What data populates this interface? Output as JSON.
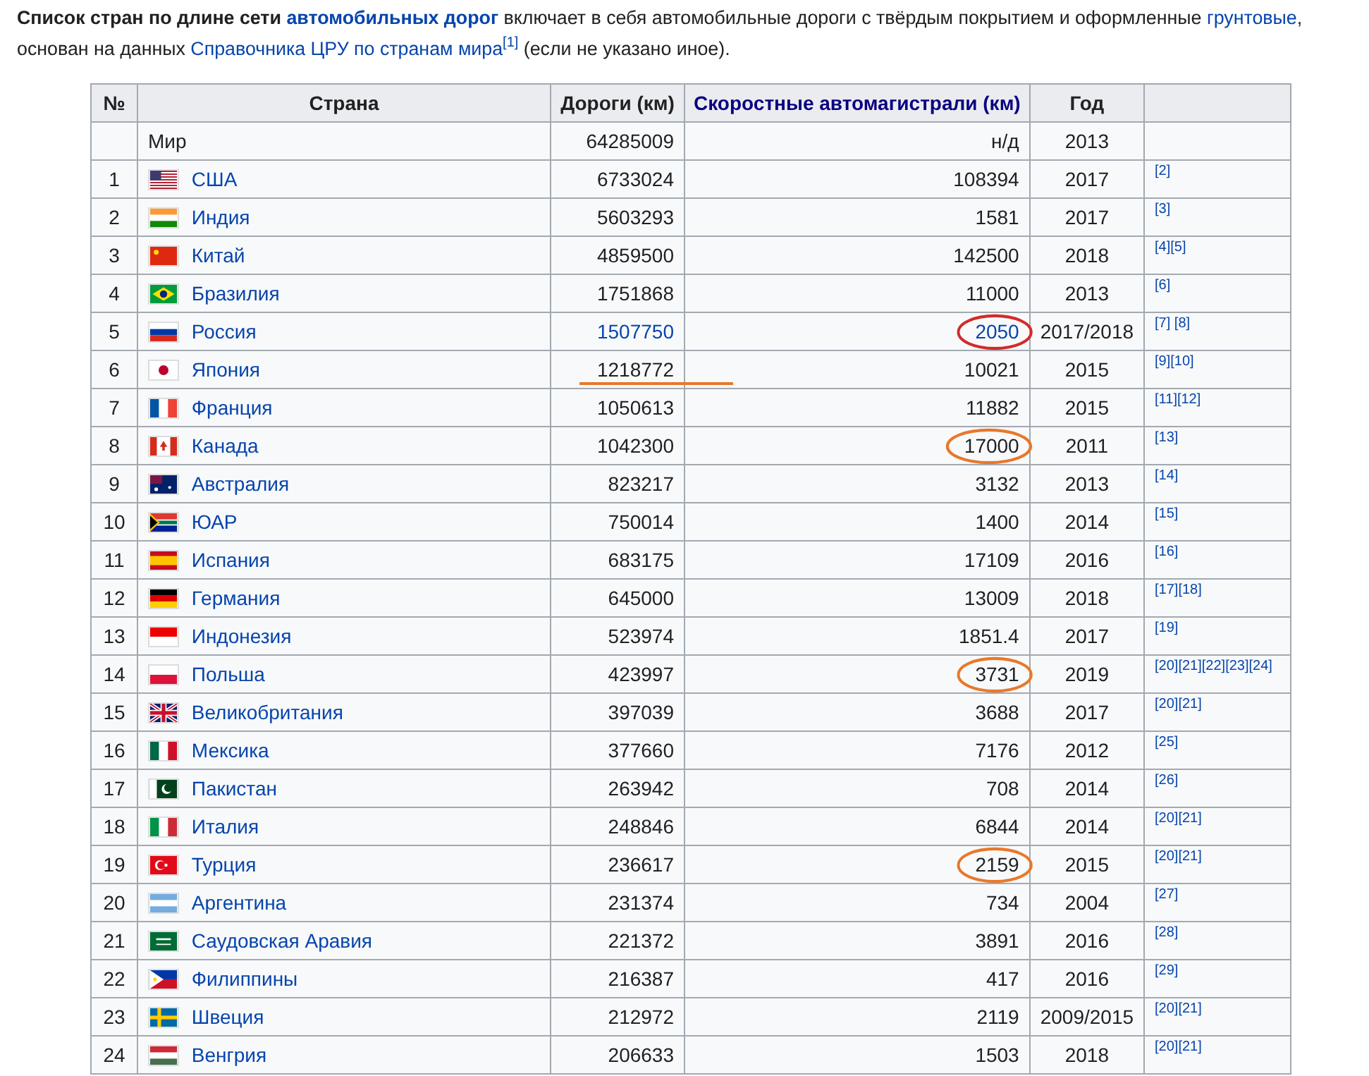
{
  "intro": [
    {
      "text": "Список стран по длине сети ",
      "bold": true,
      "link": false
    },
    {
      "text": "автомобильных дорог",
      "bold": true,
      "link": true
    },
    {
      "text": " включает в себя автомобильные дороги с твёрдым покрытием и оформленные ",
      "bold": false,
      "link": false
    },
    {
      "text": "грунтовые",
      "bold": false,
      "link": true
    },
    {
      "text": ", основан на данных ",
      "bold": false,
      "link": false
    },
    {
      "text": "Справочника ЦРУ по странам мира",
      "bold": false,
      "link": true
    },
    {
      "text": "[1]",
      "link": true,
      "sup": true
    },
    {
      "text": " (если не указано иное).",
      "bold": false,
      "link": false
    }
  ],
  "table": {
    "columns": [
      {
        "label": "№",
        "link": false
      },
      {
        "label": "Страна",
        "link": false
      },
      {
        "label": "Дороги (км)",
        "link": false
      },
      {
        "label": "Скоростные автомагистрали (км)",
        "link": true
      },
      {
        "label": "Год",
        "link": false
      }
    ],
    "rows": [
      {
        "kind": "world",
        "country": "Мир",
        "roads": "64285009",
        "expressways": "н/д",
        "year": "2013"
      },
      {
        "kind": "country",
        "num": "1",
        "country": "США",
        "roads": "6733024",
        "expressways": "108394",
        "year": "2017",
        "refs": "[2]"
      },
      {
        "kind": "country",
        "num": "2",
        "country": "Индия",
        "roads": "5603293",
        "expressways": "1581",
        "year": "2017",
        "refs": "[3]"
      },
      {
        "kind": "country",
        "num": "3",
        "country": "Китай",
        "roads": "4859500",
        "expressways": "142500",
        "year": "2018",
        "refs": "[4][5]"
      },
      {
        "kind": "country",
        "num": "4",
        "country": "Бразилия",
        "roads": "1751868",
        "expressways": "11000",
        "year": "2013",
        "refs": "[6]"
      },
      {
        "kind": "country",
        "num": "5",
        "country": "Россия",
        "roads": "1507750",
        "roads_link": true,
        "expressways": "2050",
        "expressways_link": true,
        "circled": true,
        "color": "#d42a2a",
        "year": "2017/2018",
        "refs": "[7] [8]"
      },
      {
        "kind": "country",
        "num": "6",
        "country": "Япония",
        "roads": "1218772",
        "underlined": true,
        "color": "#e8782a",
        "expressways": "10021",
        "year": "2015",
        "refs": "[9][10]"
      },
      {
        "kind": "country",
        "num": "7",
        "country": "Франция",
        "roads": "1050613",
        "expressways": "11882",
        "year": "2015",
        "refs": "[11][12]"
      },
      {
        "kind": "country",
        "num": "8",
        "country": "Канада",
        "roads": "1042300",
        "expressways": "17000",
        "circled": true,
        "color": "#e8782a",
        "year": "2011",
        "refs": "[13]"
      },
      {
        "kind": "country",
        "num": "9",
        "country": "Австралия",
        "roads": "823217",
        "expressways": "3132",
        "year": "2013",
        "refs": "[14]"
      },
      {
        "kind": "country",
        "num": "10",
        "country": "ЮАР",
        "roads": "750014",
        "expressways": "1400",
        "year": "2014",
        "refs": "[15]"
      },
      {
        "kind": "country",
        "num": "11",
        "country": "Испания",
        "roads": "683175",
        "expressways": "17109",
        "year": "2016",
        "refs": "[16]"
      },
      {
        "kind": "country",
        "num": "12",
        "country": "Германия",
        "roads": "645000",
        "expressways": "13009",
        "year": "2018",
        "refs": "[17][18]"
      },
      {
        "kind": "country",
        "num": "13",
        "country": "Индонезия",
        "roads": "523974",
        "expressways": "1851.4",
        "year": "2017",
        "refs": "[19]"
      },
      {
        "kind": "country",
        "num": "14",
        "country": "Польша",
        "roads": "423997",
        "expressways": "3731",
        "circled": true,
        "color": "#e8782a",
        "year": "2019",
        "refs": "[20][21][22][23][24]"
      },
      {
        "kind": "country",
        "num": "15",
        "country": "Великобритания",
        "roads": "397039",
        "expressways": "3688",
        "year": "2017",
        "refs": "[20][21]"
      },
      {
        "kind": "country",
        "num": "16",
        "country": "Мексика",
        "roads": "377660",
        "expressways": "7176",
        "year": "2012",
        "refs": "[25]"
      },
      {
        "kind": "country",
        "num": "17",
        "country": "Пакистан",
        "roads": "263942",
        "expressways": "708",
        "year": "2014",
        "refs": "[26]"
      },
      {
        "kind": "country",
        "num": "18",
        "country": "Италия",
        "roads": "248846",
        "expressways": "6844",
        "year": "2014",
        "refs": "[20][21]"
      },
      {
        "kind": "country",
        "num": "19",
        "country": "Турция",
        "roads": "236617",
        "expressways": "2159",
        "circled": true,
        "color": "#e8782a",
        "year": "2015",
        "refs": "[20][21]"
      },
      {
        "kind": "country",
        "num": "20",
        "country": "Аргентина",
        "roads": "231374",
        "expressways": "734",
        "year": "2004",
        "refs": "[27]"
      },
      {
        "kind": "country",
        "num": "21",
        "country": "Саудовская Аравия",
        "roads": "221372",
        "expressways": "3891",
        "year": "2016",
        "refs": "[28]"
      },
      {
        "kind": "country",
        "num": "22",
        "country": "Филиппины",
        "roads": "216387",
        "expressways": "417",
        "year": "2016",
        "refs": "[29]"
      },
      {
        "kind": "country",
        "num": "23",
        "country": "Швеция",
        "roads": "212972",
        "expressways": "2119",
        "year": "2009/2015",
        "refs": "[20][21]"
      },
      {
        "kind": "country",
        "num": "24",
        "country": "Венгрия",
        "roads": "206633",
        "expressways": "1503",
        "year": "2018",
        "refs": "[20][21]"
      }
    ]
  }
}
